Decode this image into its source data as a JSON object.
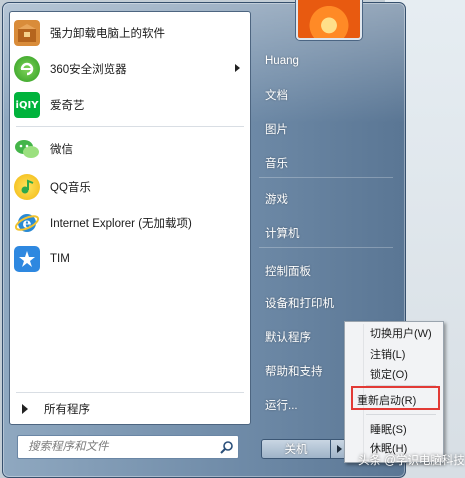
{
  "programs": [
    {
      "label": "强力卸载电脑上的软件",
      "icon": "uninstall-box-icon",
      "color": "#c8732a",
      "has_arrow": false
    },
    {
      "label": "360安全浏览器",
      "icon": "360-browser-icon",
      "color": "#3fae2a",
      "has_arrow": true
    },
    {
      "label": "爱奇艺",
      "icon": "iqiyi-icon",
      "color": "#00b33c",
      "has_arrow": false
    },
    {
      "label": "微信",
      "icon": "wechat-icon",
      "color": "#44b549",
      "has_arrow": false
    },
    {
      "label": "QQ音乐",
      "icon": "qq-music-icon",
      "color": "#f3c21a",
      "has_arrow": false
    },
    {
      "label": "Internet Explorer (无加载项)",
      "icon": "internet-explorer-icon",
      "color": "#2a8ad4",
      "has_arrow": false
    },
    {
      "label": "TIM",
      "icon": "tim-icon",
      "color": "#2e88e0",
      "has_arrow": false
    }
  ],
  "all_programs": "所有程序",
  "search": {
    "placeholder": "搜索程序和文件"
  },
  "right_items": [
    "Huang",
    "文档",
    "图片",
    "音乐",
    "游戏",
    "计算机",
    "控制面板",
    "设备和打印机",
    "默认程序",
    "帮助和支持",
    "运行..."
  ],
  "shutdown": {
    "label": "关机"
  },
  "power_menu": {
    "items": [
      "切换用户(W)",
      "注销(L)",
      "锁定(O)",
      "重新启动(R)",
      "睡眠(S)",
      "休眠(H)"
    ],
    "highlighted": "重新启动(R)"
  },
  "watermark": "头条 @学识电脑科技",
  "colors": {
    "highlight_border": "#e23a35",
    "menu_frame": "#6e8aa7"
  }
}
